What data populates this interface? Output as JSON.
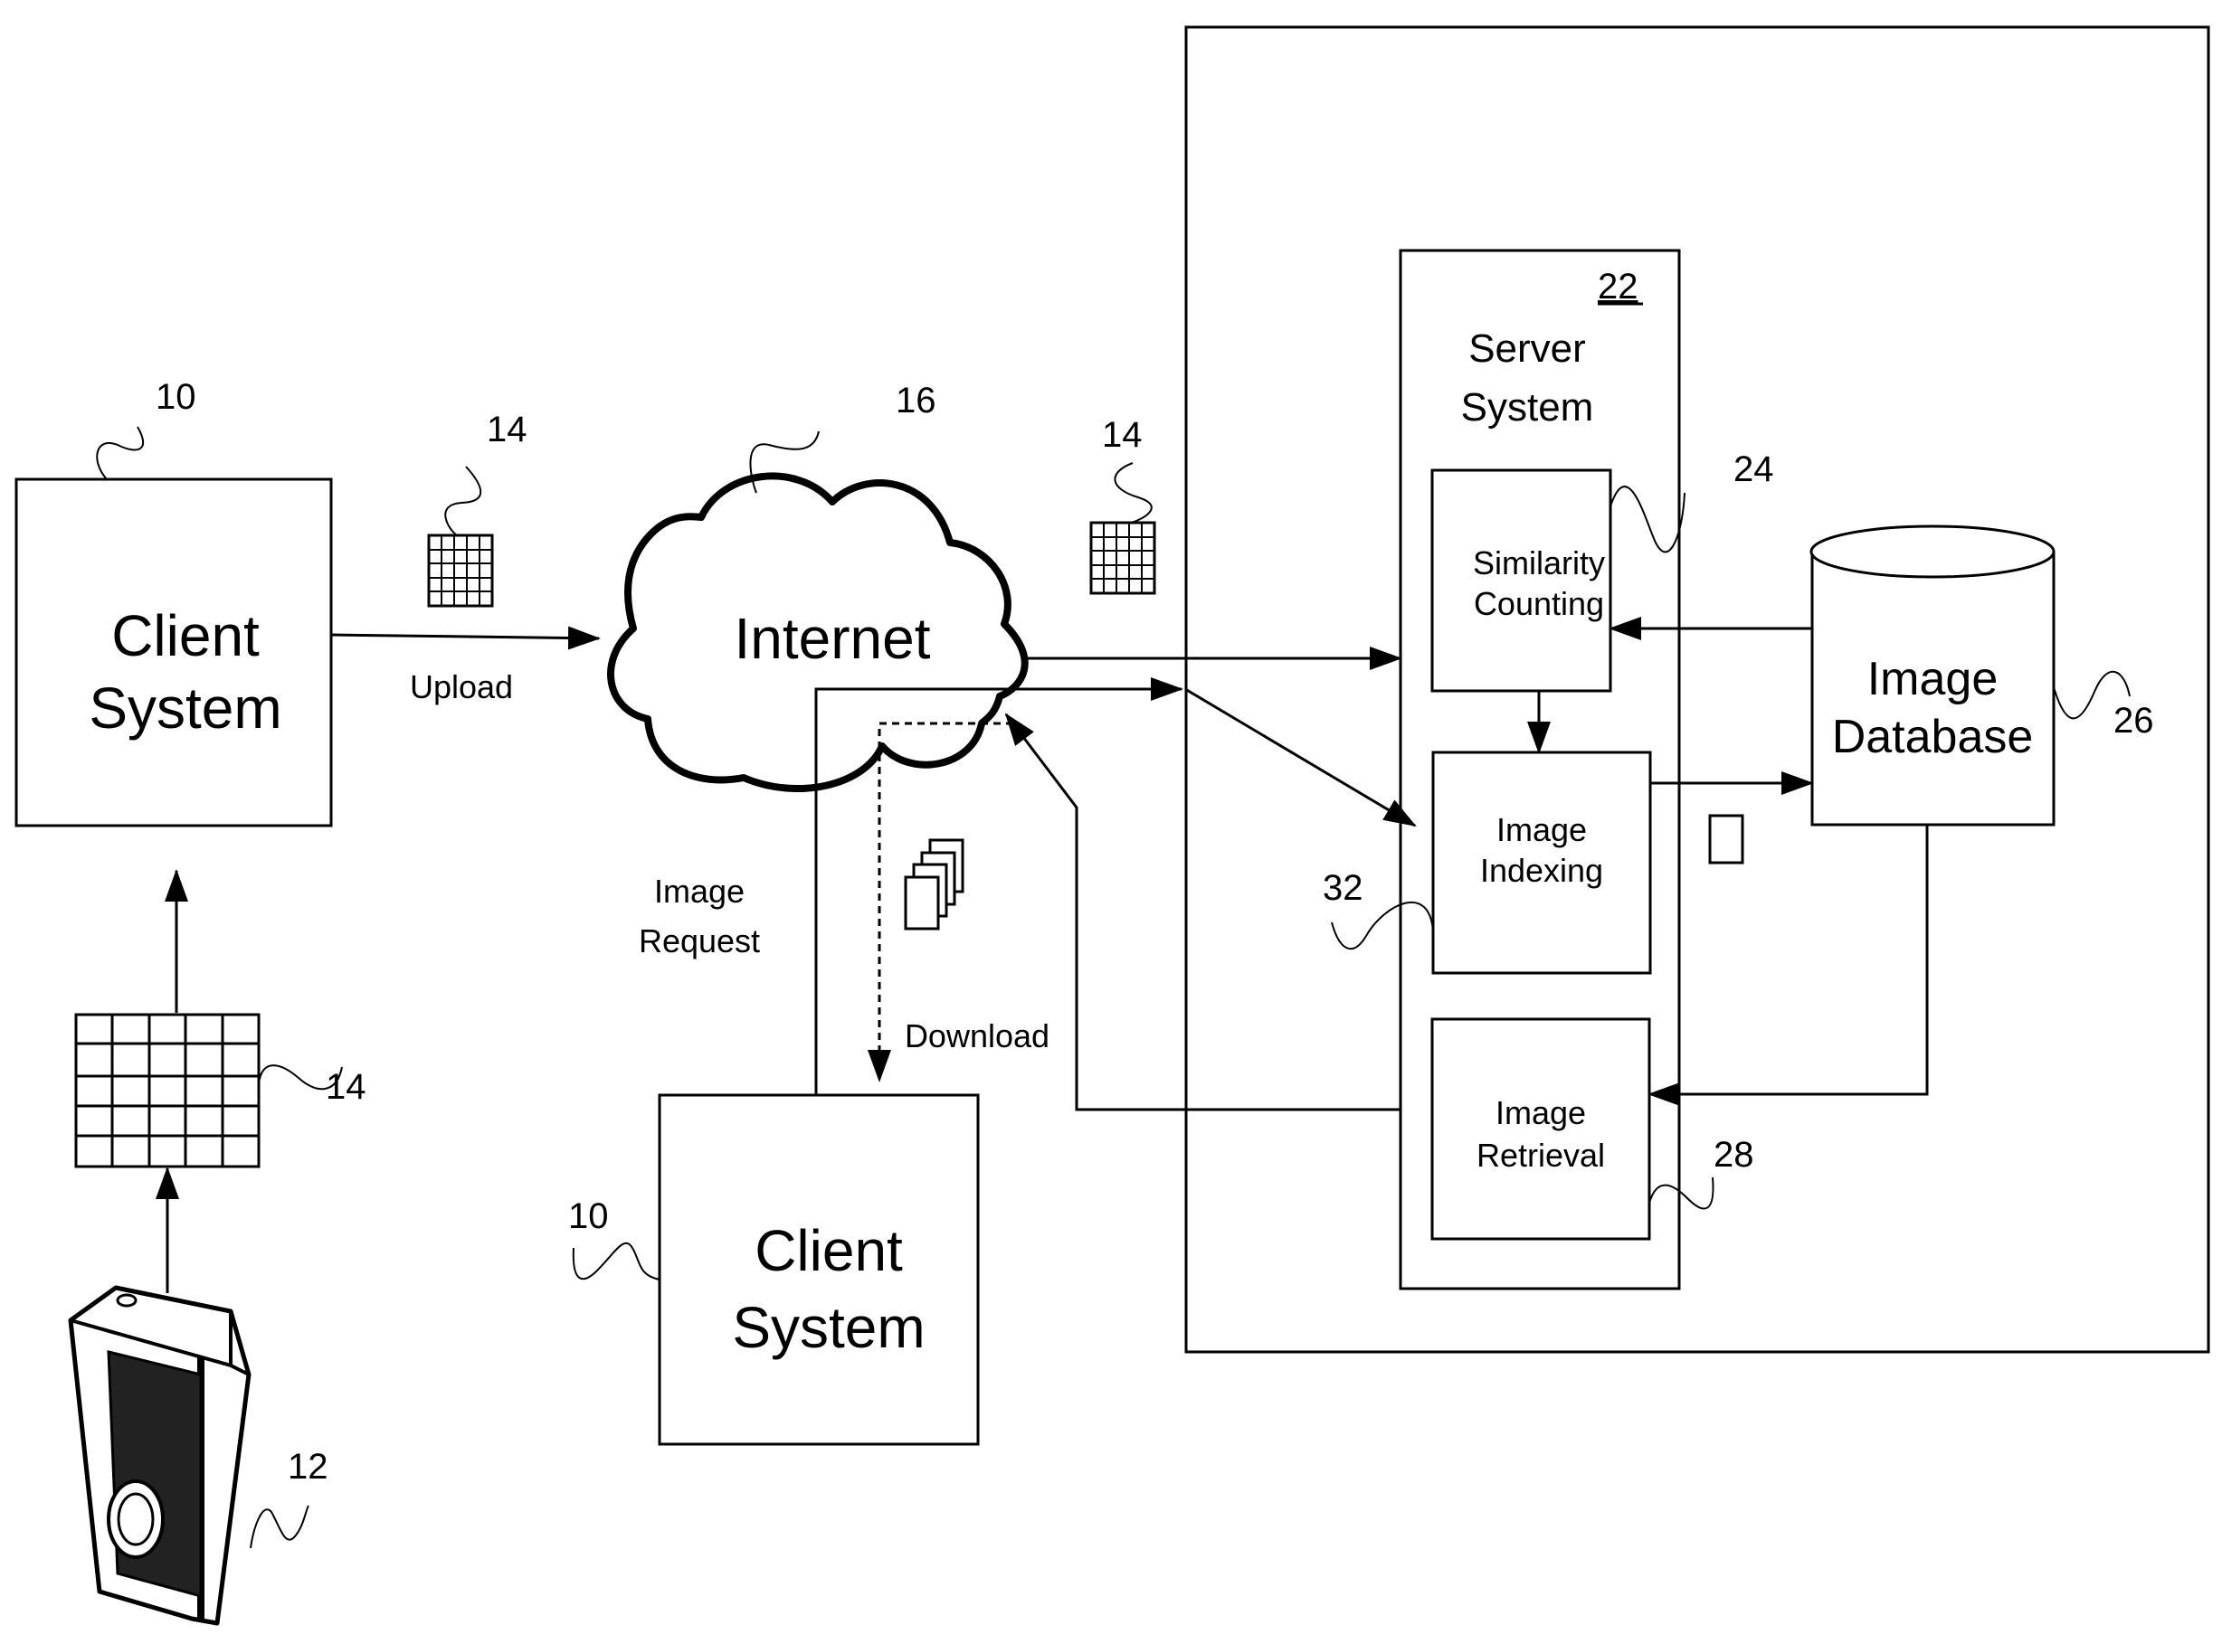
{
  "diagram": {
    "client_top": {
      "line1": "Client",
      "line2": "System",
      "ref": "10"
    },
    "client_bottom": {
      "line1": "Client",
      "line2": "System",
      "ref": "10"
    },
    "camera": {
      "ref": "12",
      "icon": "camera-icon"
    },
    "image_grid": {
      "ref": "14",
      "icon": "image-grid-icon"
    },
    "upload_image": {
      "ref": "14"
    },
    "server_image": {
      "ref": "14"
    },
    "internet": {
      "label": "Internet",
      "ref": "16"
    },
    "upload_label": "Upload",
    "image_request": {
      "line1": "Image",
      "line2": "Request"
    },
    "download_label": "Download",
    "server": {
      "line1": "Server",
      "line2": "System",
      "ref": "22"
    },
    "similarity": {
      "line1": "Similarity",
      "line2": "Counting",
      "ref": "24"
    },
    "indexing": {
      "line1": "Image",
      "line2": "Indexing",
      "ref": "32"
    },
    "retrieval": {
      "line1": "Image",
      "line2": "Retrieval",
      "ref": "28"
    },
    "database": {
      "line1": "Image",
      "line2": "Database",
      "ref": "26"
    }
  }
}
